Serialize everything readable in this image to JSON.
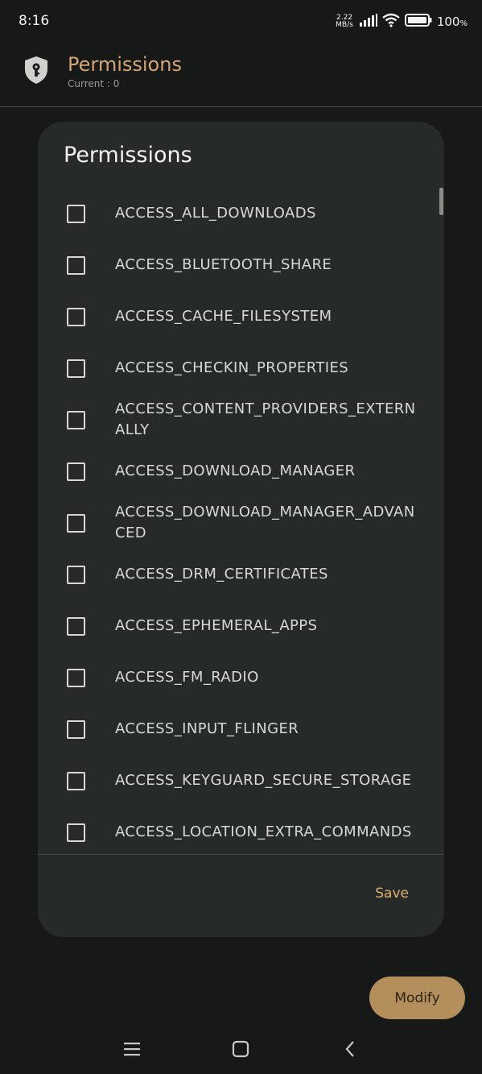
{
  "status_bar": {
    "time": "8:16",
    "speed_value": "2.22",
    "speed_unit": "MB/s",
    "battery_percent": "100",
    "battery_unit": "%"
  },
  "header": {
    "title": "Permissions",
    "subtitle": "Current : 0",
    "icon": "shield-key-icon"
  },
  "dialog": {
    "title": "Permissions",
    "permissions": [
      "ACCESS_ALL_DOWNLOADS",
      "ACCESS_BLUETOOTH_SHARE",
      "ACCESS_CACHE_FILESYSTEM",
      "ACCESS_CHECKIN_PROPERTIES",
      "ACCESS_CONTENT_PROVIDERS_EXTERNALLY",
      "ACCESS_DOWNLOAD_MANAGER",
      "ACCESS_DOWNLOAD_MANAGER_ADVANCED",
      "ACCESS_DRM_CERTIFICATES",
      "ACCESS_EPHEMERAL_APPS",
      "ACCESS_FM_RADIO",
      "ACCESS_INPUT_FLINGER",
      "ACCESS_KEYGUARD_SECURE_STORAGE",
      "ACCESS_LOCATION_EXTRA_COMMANDS"
    ],
    "save_label": "Save"
  },
  "fab": {
    "label": "Modify"
  },
  "nav": {
    "icons": [
      "menu-icon",
      "home-icon",
      "back-icon"
    ]
  },
  "colors": {
    "background": "#171918",
    "dialog": "#262a28",
    "accent": "#d4a574",
    "fab": "#b48e5b"
  }
}
